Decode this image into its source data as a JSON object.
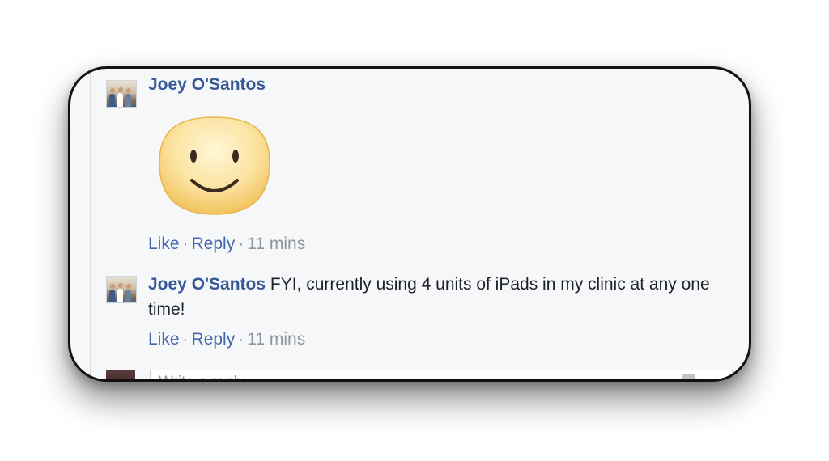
{
  "comments": [
    {
      "author": "Joey O'Santos",
      "text": "",
      "sticker": "smiley-face-sticker",
      "like_label": "Like",
      "reply_label": "Reply",
      "time": "11 mins"
    },
    {
      "author": "Joey O'Santos",
      "text": "FYI, currently using 4 units of iPads in my clinic at any one time!",
      "like_label": "Like",
      "reply_label": "Reply",
      "time": "11 mins"
    }
  ],
  "separator": "·",
  "composer": {
    "placeholder": "Write a reply..."
  },
  "colors": {
    "author_link": "#365899",
    "action_link": "#4267b2",
    "meta_text": "#90949c",
    "card_background": "#f6f7f9"
  }
}
